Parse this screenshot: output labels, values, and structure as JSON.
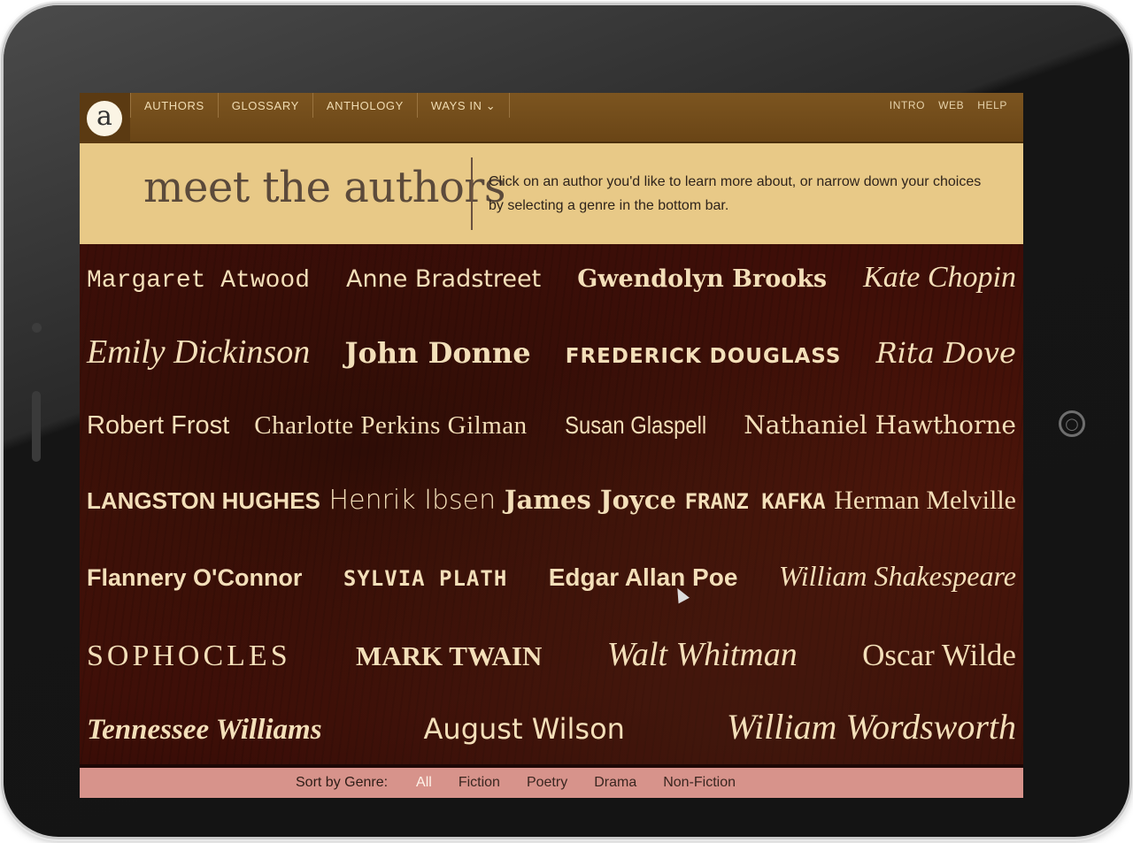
{
  "nav": {
    "logo_letter": "a",
    "items": [
      "AUTHORS",
      "GLOSSARY",
      "ANTHOLOGY",
      "WAYS IN ⌄"
    ],
    "right_items": [
      "INTRO",
      "WEB",
      "HELP"
    ]
  },
  "header": {
    "title": "meet the authors",
    "description": "Click on an author you'd like to learn more about, or narrow down your choices by selecting a genre in the bottom bar."
  },
  "authors": [
    "Margaret Atwood",
    "Anne Bradstreet",
    "Gwendolyn Brooks",
    "Kate Chopin",
    "Emily Dickinson",
    "John Donne",
    "FREDERICK DOUGLASS",
    "Rita Dove",
    "Robert Frost",
    "Charlotte Perkins Gilman",
    "Susan Glaspell",
    "Nathaniel Hawthorne",
    "LANGSTON HUGHES",
    "Henrik Ibsen",
    "James Joyce",
    "FRANZ KAFKA",
    "Herman Melville",
    "Flannery O'Connor",
    "SYLVIA PLATH",
    "Edgar Allan Poe",
    "William Shakespeare",
    "SOPHOCLES",
    "MARK TWAIN",
    "Walt Whitman",
    "Oscar Wilde",
    "Tennessee Williams",
    "August Wilson",
    "William Wordsworth"
  ],
  "genre_bar": {
    "label": "Sort by Genre:",
    "options": [
      "All",
      "Fiction",
      "Poetry",
      "Drama",
      "Non-Fiction"
    ],
    "selected": "All"
  },
  "colors": {
    "nav_bg": "#6a4516",
    "header_bg": "#e8c987",
    "author_bg": "#4b1409",
    "author_text": "#f3dfb9",
    "genre_bar_bg": "#d7938b"
  }
}
